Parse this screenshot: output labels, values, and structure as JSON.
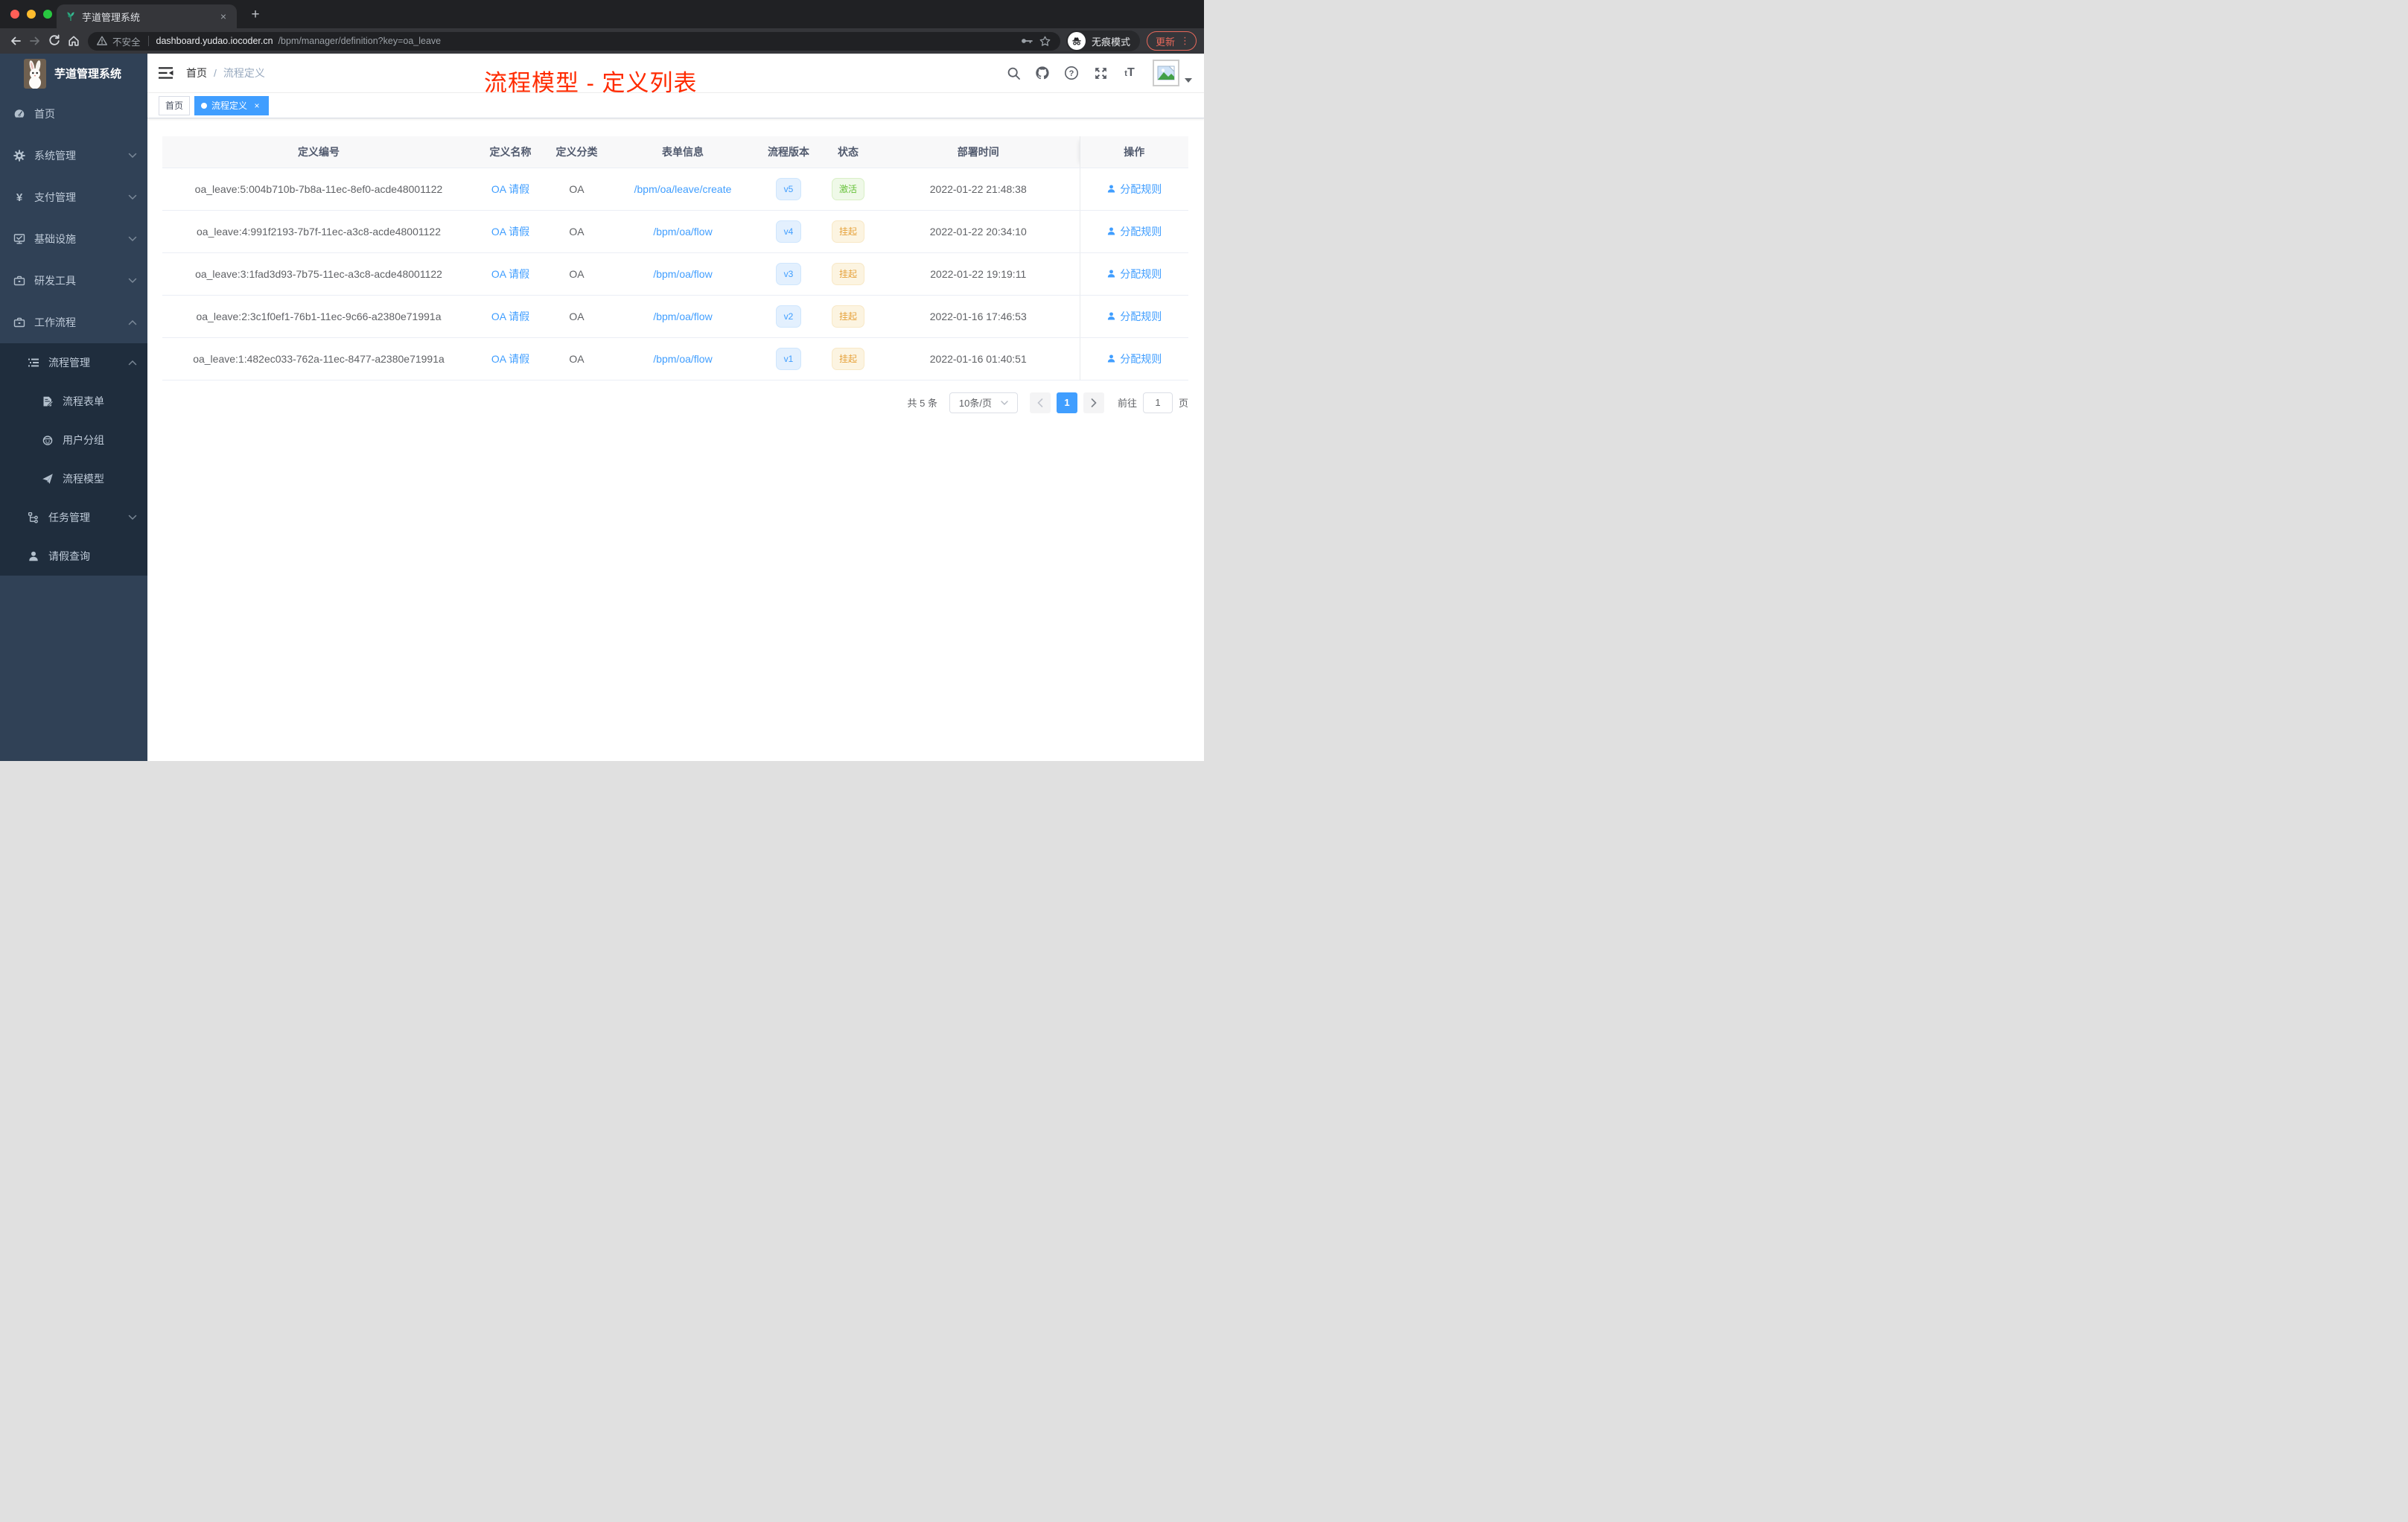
{
  "colors": {
    "accent": "#409eff",
    "success": "#67c23a",
    "warning": "#e6a23c",
    "annotation_red": "#ff2b00",
    "update_coral": "#e8695b",
    "sidebar_bg": "#304156",
    "submenu_bg": "#1f2d3d",
    "sidebar_text": "#bfcbd9",
    "chrome_frame": "#202124",
    "chrome_toolbar": "#35363a"
  },
  "glyphs": {
    "tab_close": "×",
    "new_tab": "+",
    "kebab": "⋮",
    "breadcrumb_sep": "/",
    "tag_close": "×",
    "prev_arrow": "‹",
    "next_arrow": "›",
    "yen": "¥",
    "font_size": "tT",
    "help": "?"
  },
  "browser": {
    "tab_title": "芋道管理系统",
    "security_label": "不安全",
    "url_host": "dashboard.yudao.iocoder.cn",
    "url_path": "/bpm/manager/definition?key=oa_leave",
    "incognito_label": "无痕模式",
    "update_label": "更新"
  },
  "sidebar": {
    "logo_title": "芋道管理系统",
    "items": [
      {
        "label": "首页",
        "icon": "dashboard-icon"
      },
      {
        "label": "系统管理",
        "icon": "gear-icon",
        "chevron": "down"
      },
      {
        "label": "支付管理",
        "icon": "yen-icon",
        "chevron": "down"
      },
      {
        "label": "基础设施",
        "icon": "monitor-icon",
        "chevron": "down"
      },
      {
        "label": "研发工具",
        "icon": "toolbox-icon",
        "chevron": "down"
      },
      {
        "label": "工作流程",
        "icon": "briefcase-icon",
        "chevron": "up"
      },
      {
        "label": "流程管理",
        "icon": "list-icon",
        "chevron": "up",
        "level": 2
      },
      {
        "label": "流程表单",
        "icon": "form-icon",
        "level": 3
      },
      {
        "label": "用户分组",
        "icon": "robot-icon",
        "level": 3
      },
      {
        "label": "流程模型",
        "icon": "send-icon",
        "level": 3
      },
      {
        "label": "任务管理",
        "icon": "tree-icon",
        "chevron": "down",
        "level": 2
      },
      {
        "label": "请假查询",
        "icon": "user-icon",
        "level": 2
      }
    ]
  },
  "header": {
    "breadcrumb": [
      "首页",
      "流程定义"
    ],
    "annotation": "流程模型 - 定义列表",
    "action_icons": [
      "search-icon",
      "github-icon",
      "help-icon",
      "fullscreen-icon",
      "font-size-icon",
      "avatar",
      "caret-down-icon"
    ]
  },
  "tags": {
    "items": [
      {
        "label": "首页",
        "active": false
      },
      {
        "label": "流程定义",
        "active": true
      }
    ]
  },
  "table": {
    "columns": [
      "定义编号",
      "定义名称",
      "定义分类",
      "表单信息",
      "流程版本",
      "状态",
      "部署时间",
      "操作"
    ],
    "rows": [
      {
        "id": "oa_leave:5:004b710b-7b8a-11ec-8ef0-acde48001122",
        "name": "OA 请假",
        "category": "OA",
        "form": "/bpm/oa/leave/create",
        "version": "v5",
        "status": "激活",
        "status_type": "success",
        "time": "2022-01-22 21:48:38",
        "action": "分配规则"
      },
      {
        "id": "oa_leave:4:991f2193-7b7f-11ec-a3c8-acde48001122",
        "name": "OA 请假",
        "category": "OA",
        "form": "/bpm/oa/flow",
        "version": "v4",
        "status": "挂起",
        "status_type": "warning",
        "time": "2022-01-22 20:34:10",
        "action": "分配规则"
      },
      {
        "id": "oa_leave:3:1fad3d93-7b75-11ec-a3c8-acde48001122",
        "name": "OA 请假",
        "category": "OA",
        "form": "/bpm/oa/flow",
        "version": "v3",
        "status": "挂起",
        "status_type": "warning",
        "time": "2022-01-22 19:19:11",
        "action": "分配规则"
      },
      {
        "id": "oa_leave:2:3c1f0ef1-76b1-11ec-9c66-a2380e71991a",
        "name": "OA 请假",
        "category": "OA",
        "form": "/bpm/oa/flow",
        "version": "v2",
        "status": "挂起",
        "status_type": "warning",
        "time": "2022-01-16 17:46:53",
        "action": "分配规则"
      },
      {
        "id": "oa_leave:1:482ec033-762a-11ec-8477-a2380e71991a",
        "name": "OA 请假",
        "category": "OA",
        "form": "/bpm/oa/flow",
        "version": "v1",
        "status": "挂起",
        "status_type": "warning",
        "time": "2022-01-16 01:40:51",
        "action": "分配规则"
      }
    ]
  },
  "pagination": {
    "total": "共 5 条",
    "page_size": "10条/页",
    "current_page": "1",
    "goto_label": "前往",
    "goto_value": "1",
    "page_unit": "页"
  }
}
